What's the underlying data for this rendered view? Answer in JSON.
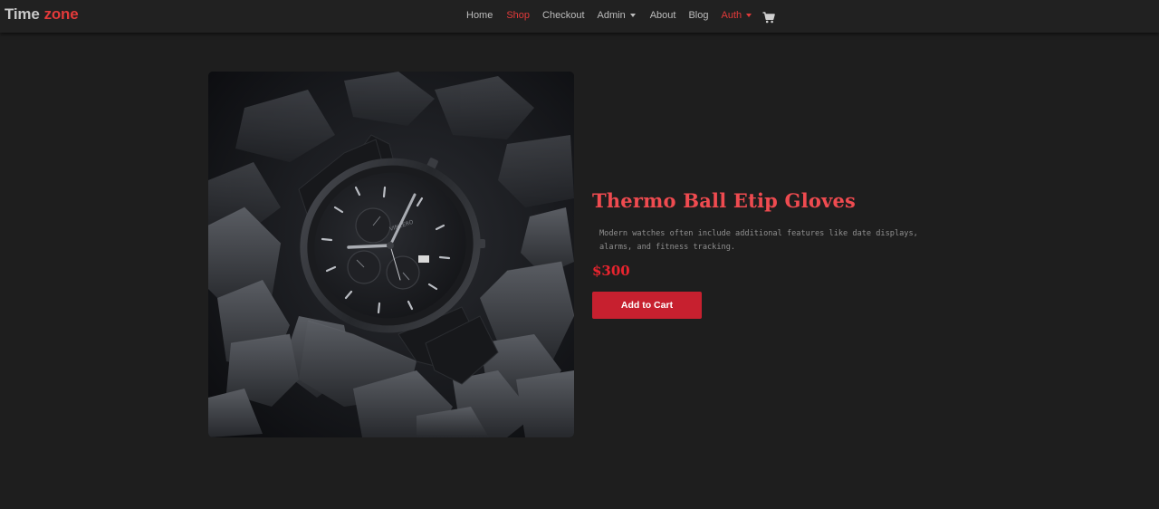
{
  "brand": {
    "part1": "Time",
    "part2": "zone"
  },
  "nav": {
    "home": "Home",
    "shop": "Shop",
    "checkout": "Checkout",
    "admin": "Admin",
    "about": "About",
    "blog": "Blog",
    "auth": "Auth",
    "cart_icon": "shopping-cart-icon",
    "active_item": "Shop"
  },
  "product": {
    "title": "Thermo Ball Etip Gloves",
    "description": "Modern watches often include additional features like date displays, alarms, and fitness tracking.",
    "price": "$300",
    "add_to_cart_label": "Add to Cart",
    "watch_brand_text": "VINCERO"
  },
  "colors": {
    "background": "#1e1e1e",
    "navbar": "#212121",
    "accent": "#e23a3a",
    "title": "#ef4b50",
    "button": "#c7202f"
  }
}
